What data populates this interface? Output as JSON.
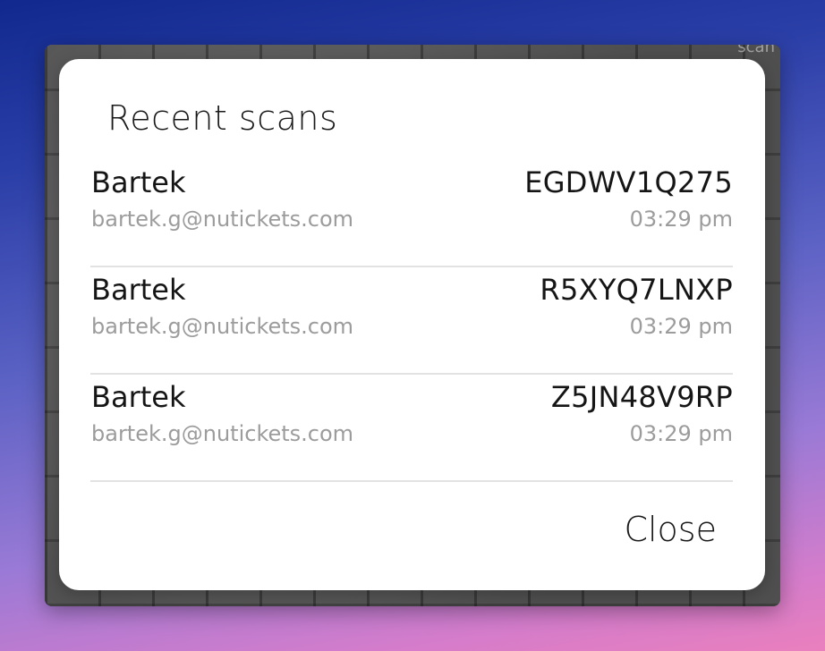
{
  "backdrop": {
    "peek_text": "scan"
  },
  "dialog": {
    "title": "Recent scans",
    "close_label": "Close"
  },
  "scans": [
    {
      "name": "Bartek",
      "email": "bartek.g@nutickets.com",
      "code": "EGDWV1Q275",
      "time": "03:29 pm"
    },
    {
      "name": "Bartek",
      "email": "bartek.g@nutickets.com",
      "code": "R5XYQ7LNXP",
      "time": "03:29 pm"
    },
    {
      "name": "Bartek",
      "email": "bartek.g@nutickets.com",
      "code": "Z5JN48V9RP",
      "time": "03:29 pm"
    }
  ],
  "colors": {
    "dialog_bg": "#ffffff",
    "primary_text": "#151515",
    "secondary_text": "#9c9c9c",
    "divider": "#e2e2e2"
  }
}
